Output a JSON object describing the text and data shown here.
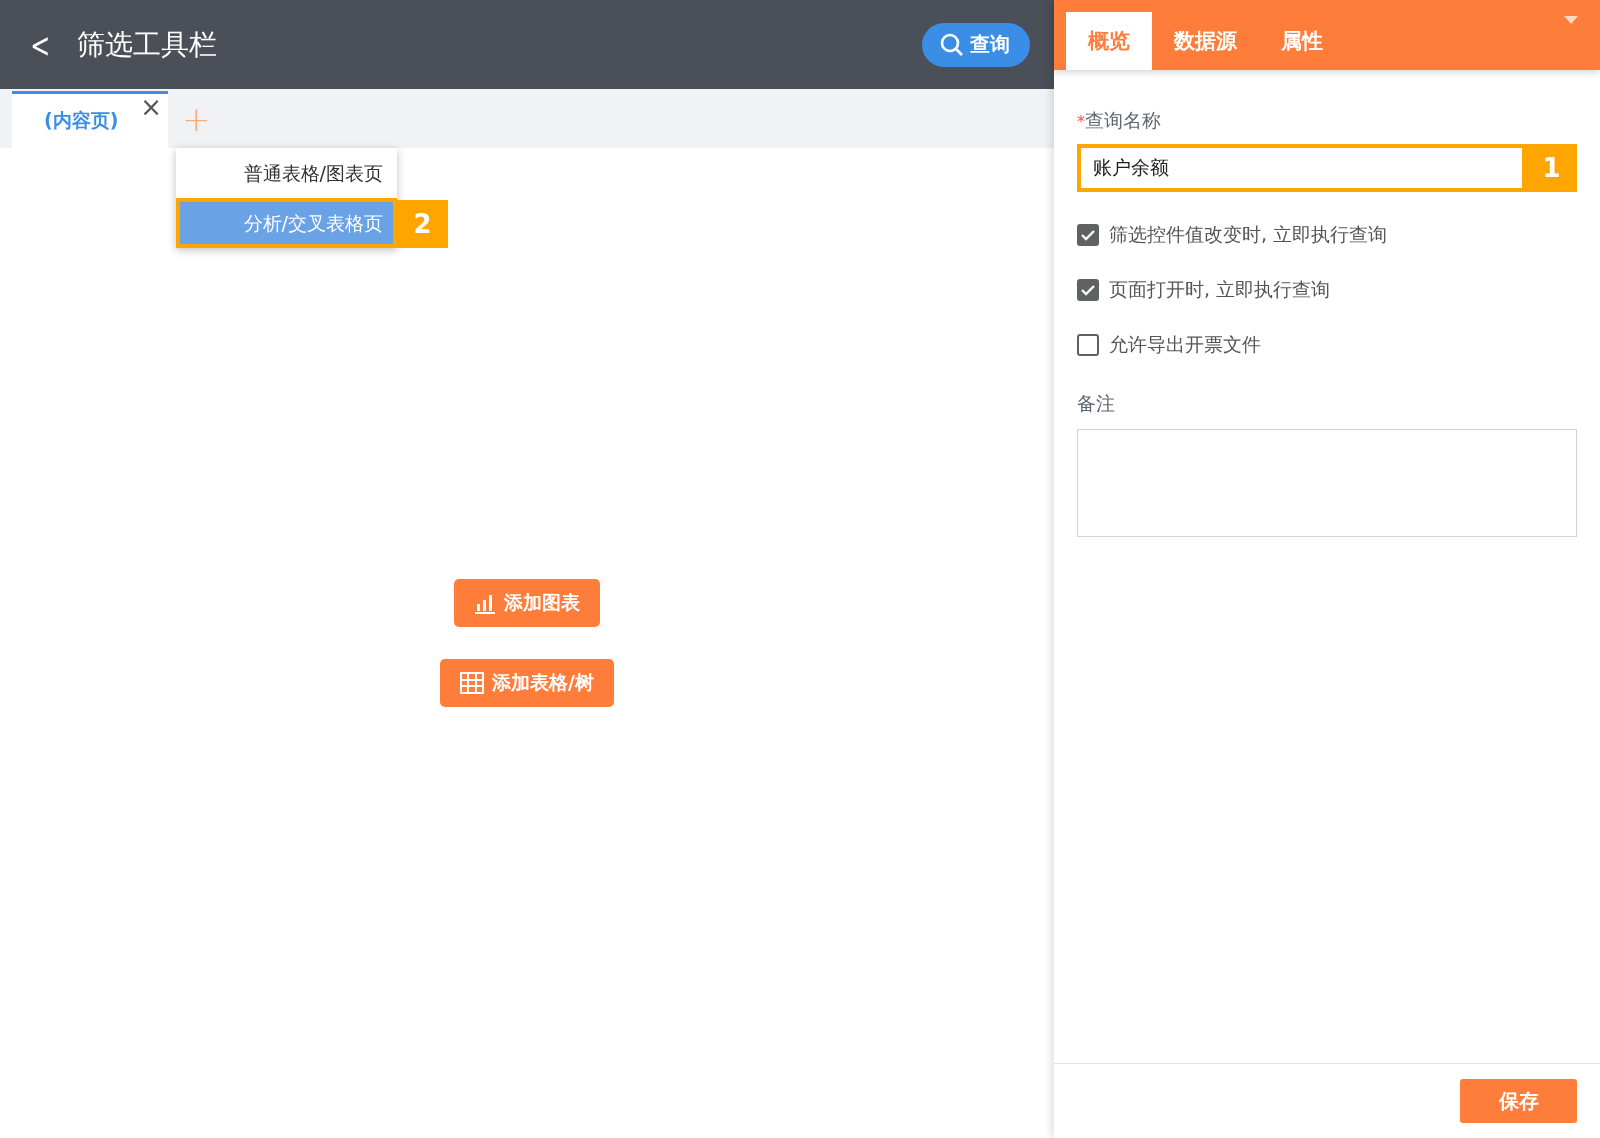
{
  "header": {
    "back": "<",
    "title": "筛选工具栏",
    "query_button": "查询"
  },
  "page_tabs": [
    {
      "label": "(内容页)",
      "selected": true,
      "close": "×"
    }
  ],
  "add_tab": "+",
  "add_menu": {
    "items": [
      {
        "label": "普通表格/图表页",
        "selected": false
      },
      {
        "label": "分析/交叉表格页",
        "selected": true,
        "callout": "2"
      }
    ]
  },
  "canvas_buttons": [
    {
      "kind": "chart",
      "label": "添加图表"
    },
    {
      "kind": "table",
      "label": "添加表格/树"
    }
  ],
  "panel": {
    "tabs": [
      {
        "label": "概览",
        "selected": true
      },
      {
        "label": "数据源",
        "selected": false
      },
      {
        "label": "属性",
        "selected": false
      }
    ],
    "name_field": {
      "required_mark": "*",
      "label": "查询名称",
      "value": "账户余额",
      "callout": "1"
    },
    "options": [
      {
        "label": "筛选控件值改变时, 立即执行查询",
        "checked": true
      },
      {
        "label": "页面打开时, 立即执行查询",
        "checked": true
      },
      {
        "label": "允许导出开票文件",
        "checked": false
      }
    ],
    "note_label": "备注",
    "save_button": "保存"
  }
}
